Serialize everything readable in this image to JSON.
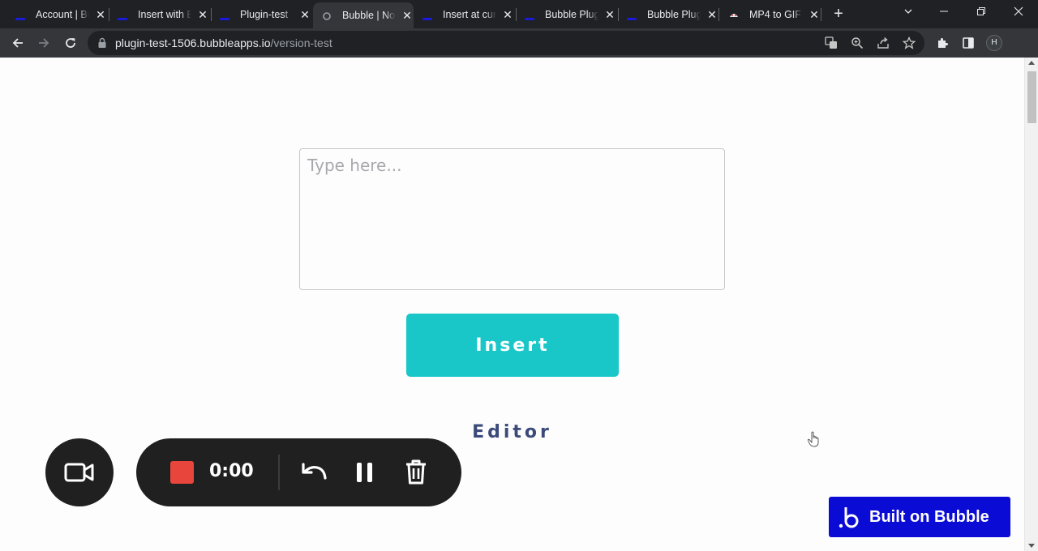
{
  "browser": {
    "tabs": [
      {
        "title": "Account | Bubble",
        "favicon": "bubble-icon",
        "active": false
      },
      {
        "title": "Insert with Bubble",
        "favicon": "bubble-icon",
        "active": false
      },
      {
        "title": "Plugin-test",
        "favicon": "bubble-icon",
        "active": false
      },
      {
        "title": "Bubble | No-code",
        "favicon": "bubble-icon",
        "active": true
      },
      {
        "title": "Insert at cursor",
        "favicon": "bubble-icon",
        "active": false
      },
      {
        "title": "Bubble Plugin",
        "favicon": "bubble-icon",
        "active": false
      },
      {
        "title": "Bubble Plugin",
        "favicon": "bubble-icon",
        "active": false
      },
      {
        "title": "MP4 to GIF",
        "favicon": "ezgif-icon",
        "active": false
      }
    ],
    "new_tab": "+",
    "url_host": "plugin-test-1506.bubbleapps.io",
    "url_path": "/version-test",
    "profile_initial": "H"
  },
  "page": {
    "textarea_placeholder": "Type here...",
    "insert_label": "Insert",
    "editor_label": "Editor",
    "badge_label": "Built on Bubble"
  },
  "recorder": {
    "time": "0:00"
  },
  "colors": {
    "insert_button": "#19c7c9",
    "editor_text": "#3b4a7a",
    "badge": "#0b0bd6",
    "recorder_bg": "#202020",
    "stop": "#e8453c"
  }
}
